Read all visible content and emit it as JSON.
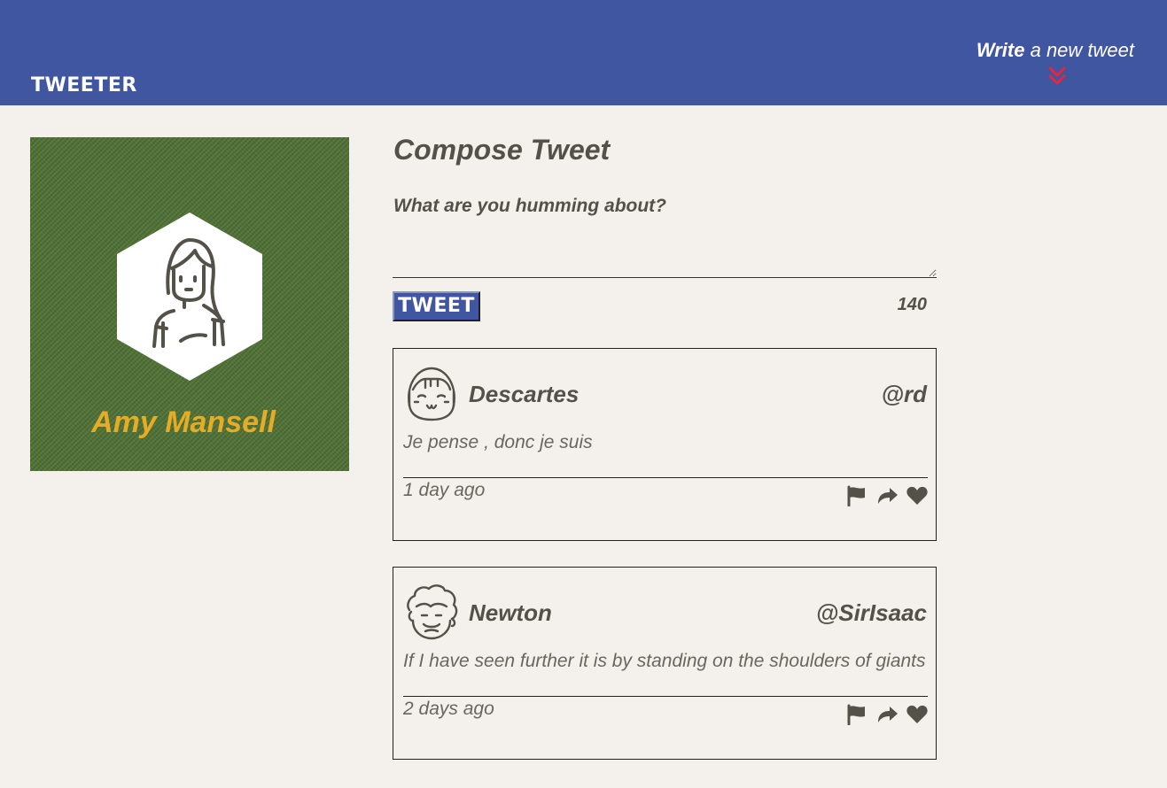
{
  "nav": {
    "brand": "TWEETER",
    "compose_toggle": {
      "bold": "Write",
      "light": " a new tweet"
    },
    "chevron_icon": "double-chevron-down-icon",
    "chevron_color": "#e8253a"
  },
  "profile": {
    "name": "Amy Mansell",
    "avatar_icon": "girl-avatar-icon",
    "name_color": "#e5ac26",
    "background_color": "#4c6e32"
  },
  "compose": {
    "title": "Compose Tweet",
    "placeholder": "What are you humming about?",
    "value": "",
    "submit_label": "TWEET",
    "char_counter": "140"
  },
  "tweets": [
    {
      "name": "Descartes",
      "handle": "@rd",
      "text": "Je pense , donc je suis",
      "time": "1 day ago",
      "avatar_icon": "smiling-girl-avatar-icon",
      "actions": [
        "flag-icon",
        "retweet-icon",
        "heart-icon"
      ]
    },
    {
      "name": "Newton",
      "handle": "@SirIsaac",
      "text": "If I have seen further it is by standing on the shoulders of giants",
      "time": "2 days ago",
      "avatar_icon": "curly-hair-man-avatar-icon",
      "actions": [
        "flag-icon",
        "retweet-icon",
        "heart-icon"
      ]
    }
  ],
  "colors": {
    "nav_background": "#4056a1",
    "page_background": "#f4f1ec",
    "text": "#545149"
  }
}
